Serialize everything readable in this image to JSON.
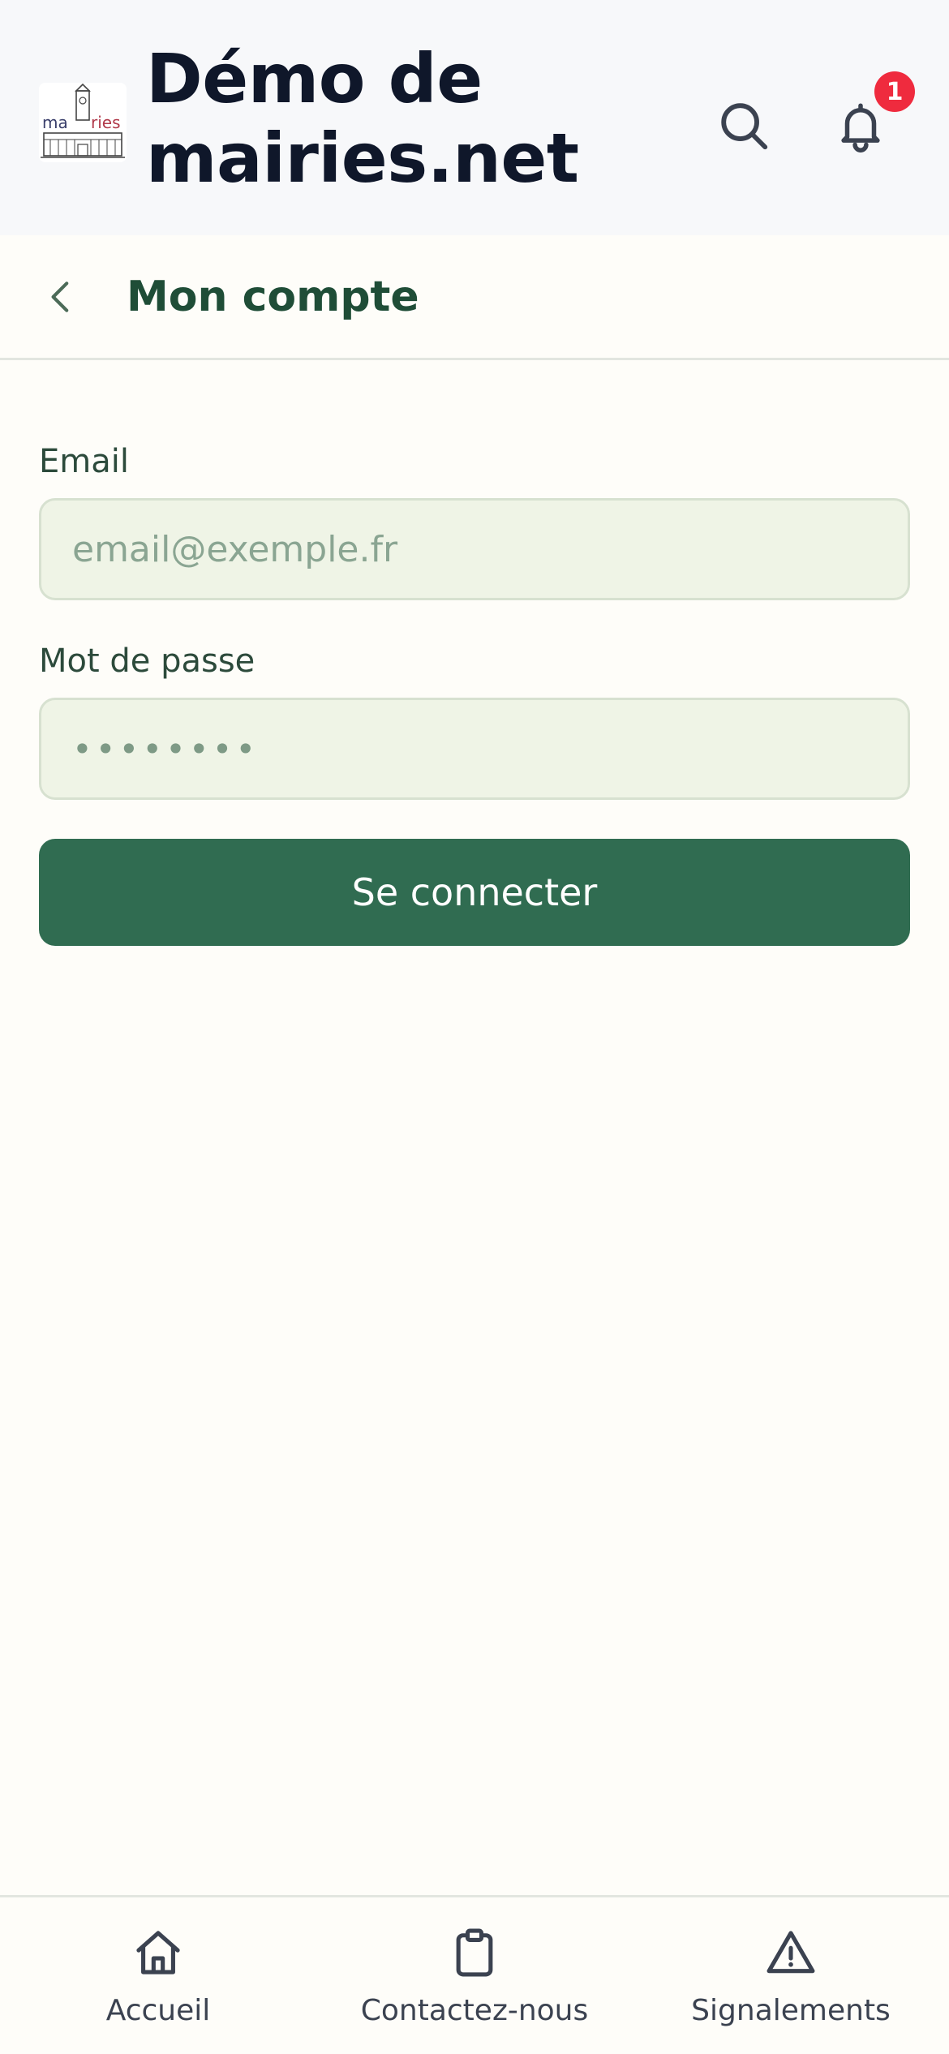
{
  "header": {
    "logo_alt": "mairies",
    "title": "Démo de mairies.net",
    "notification_count": "1",
    "icons": {
      "search": "search-icon",
      "notifications": "bell-icon"
    }
  },
  "page": {
    "title": "Mon compte",
    "back_icon": "chevron-left-icon"
  },
  "form": {
    "email_label": "Email",
    "email_placeholder": "email@exemple.fr",
    "password_label": "Mot de passe",
    "password_value": "••••••••",
    "submit_label": "Se connecter"
  },
  "nav": {
    "items": [
      {
        "label": "Accueil",
        "icon": "home-icon"
      },
      {
        "label": "Contactez-nous",
        "icon": "clipboard-icon"
      },
      {
        "label": "Signalements",
        "icon": "warning-icon"
      }
    ]
  },
  "colors": {
    "primary": "#306C51",
    "badge": "#EF2B3E",
    "input_bg": "#EFF4E6",
    "header_bg": "#F7F8FA",
    "page_bg": "#FEFDF9"
  }
}
